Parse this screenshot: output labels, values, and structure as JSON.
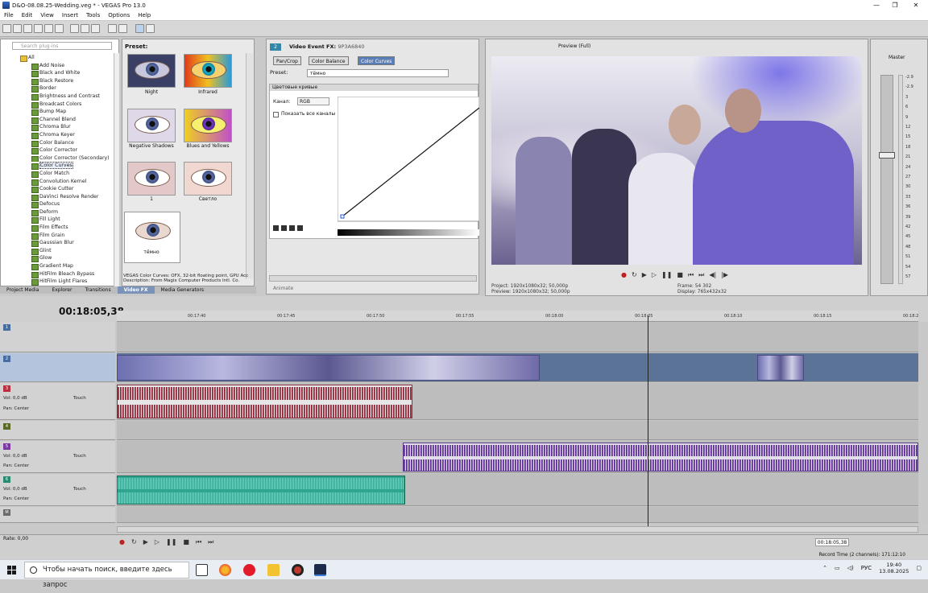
{
  "titlebar": {
    "title": "D&O-08.08.25-Wedding.veg * - VEGAS Pro 13.0"
  },
  "menu": [
    "File",
    "Edit",
    "View",
    "Insert",
    "Tools",
    "Options",
    "Help"
  ],
  "explorer": {
    "search_placeholder": "Search plug-ins",
    "root": "All",
    "items": [
      "Add Noise",
      "Black and White",
      "Black Restore",
      "Border",
      "Brightness and Contrast",
      "Broadcast Colors",
      "Bump Map",
      "Channel Blend",
      "Chroma Blur",
      "Chroma Keyer",
      "Color Balance",
      "Color Corrector",
      "Color Corrector (Secondary)",
      "Color Curves",
      "Color Match",
      "Convolution Kernel",
      "Cookie Cutter",
      "DaVinci Resolve Render",
      "Defocus",
      "Deform",
      "Fill Light",
      "Film Effects",
      "Film Grain",
      "Gaussian Blur",
      "Glint",
      "Glow",
      "Gradient Map",
      "HitFilm Bleach Bypass",
      "HitFilm Light Flares"
    ],
    "selected_index": 13
  },
  "presets": {
    "header": "Preset:",
    "thumbs": [
      "Night",
      "Infrared",
      "Negative Shadows",
      "Blues and Yellows",
      "1",
      "Светло",
      "тёмно"
    ]
  },
  "description": "VEGAS Color Curves: OFX, 32-bit floating point, GPU Acc\nDescription: From Magix Computer Products Intl. Co.",
  "bottom_tabs": [
    "Project Media",
    "Explorer",
    "Transitions",
    "Video FX",
    "Media Generators"
  ],
  "vfx": {
    "title": "Video Event FX:",
    "id": "9P3A6840",
    "num": "2",
    "chain": [
      "Pan/Crop",
      "Color Balance",
      "Color Curves"
    ],
    "preset_label": "Preset:",
    "preset_value": "тёмно",
    "panel_title": "Цветовые кривые",
    "channel_label": "Канал:",
    "channel_value": "RGB",
    "show_all": "Показать все каналы",
    "animate": "Animate"
  },
  "preview": {
    "mode": "Preview (Full)",
    "project": "Project:",
    "project_val": "1920x1080x32; 50,000p",
    "preview": "Preview:",
    "preview_val": "1920x1080x32; 50,000p",
    "frame": "Frame:",
    "frame_val": "54 302",
    "display": "Display:",
    "display_val": "765x432x32"
  },
  "mixer": {
    "label": "Master",
    "ticks": [
      "-2.9",
      "-2.9",
      "3",
      "6",
      "9",
      "12",
      "15",
      "18",
      "21",
      "24",
      "27",
      "30",
      "33",
      "36",
      "39",
      "42",
      "45",
      "48",
      "51",
      "54",
      "57"
    ]
  },
  "timeline": {
    "timecode": "00:18:05,38",
    "ruler": [
      "00:17:40",
      "00:17:45",
      "00:17:50",
      "00:17:55",
      "00:18:00",
      "00:18:05",
      "00:18:10",
      "00:18:15",
      "00:18:2"
    ],
    "tracks": [
      {
        "num": "1",
        "vol": "",
        "pan": ""
      },
      {
        "num": "2",
        "vol": "",
        "pan": ""
      },
      {
        "num": "3",
        "vol": "0,0 dB",
        "pan": "Center",
        "mode": "Touch"
      },
      {
        "num": "4",
        "vol": "",
        "pan": ""
      },
      {
        "num": "5",
        "vol": "0,0 dB",
        "pan": "Center",
        "mode": "Touch"
      },
      {
        "num": "6",
        "vol": "0,0 dB",
        "pan": "Center",
        "mode": "Touch"
      },
      {
        "num": "M",
        "vol": "",
        "pan": ""
      }
    ],
    "vol_label": "Vol:",
    "pan_label": "Pan:"
  },
  "transport": {
    "rate": "Rate: 0,00",
    "timecode": "00:18:05,38",
    "record_time": "Record Time (2 channels): 171:12:10"
  },
  "taskbar": {
    "search": "Чтобы начать поиск, введите здесь запрос",
    "lang": "РУС",
    "time": "19:40",
    "date": "13.08.2025"
  },
  "colors": {
    "accent": "#5a7fb8",
    "audio_red": "#8b2a3a",
    "audio_purple": "#5b2e8f",
    "audio_green": "#2ea58c"
  }
}
